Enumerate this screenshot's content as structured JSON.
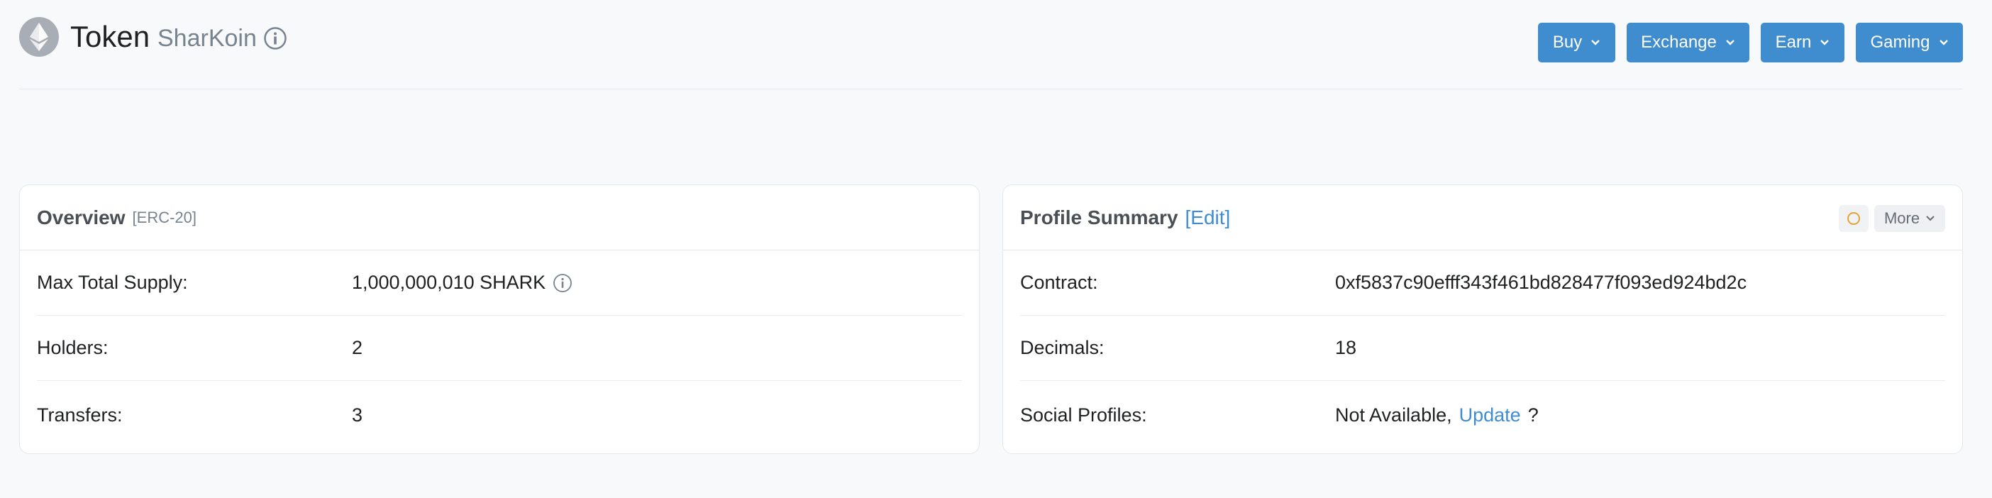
{
  "header": {
    "title": "Token",
    "token_name": "SharKoin",
    "buttons": [
      "Buy",
      "Exchange",
      "Earn",
      "Gaming"
    ]
  },
  "overview": {
    "title": "Overview",
    "standard": "[ERC-20]",
    "rows": [
      {
        "label": "Max Total Supply:",
        "value": "1,000,000,010 SHARK"
      },
      {
        "label": "Holders:",
        "value": "2"
      },
      {
        "label": "Transfers:",
        "value": "3"
      }
    ]
  },
  "profile": {
    "title": "Profile Summary",
    "edit": "[Edit]",
    "more": "More",
    "rows": [
      {
        "label": "Contract:",
        "value": "0xf5837c90efff343f461bd828477f093ed924bd2c"
      },
      {
        "label": "Decimals:",
        "value": "18"
      },
      {
        "label": "Social Profiles:",
        "value": "Not Available,",
        "link": "Update",
        "suffix": "?"
      }
    ]
  },
  "colors": {
    "accent": "#3f8ccf",
    "background": "#f8f9fb",
    "status_circle": "#e3a33a"
  },
  "icons": [
    "ethereum-logo-icon",
    "info-icon",
    "chevron-down-icon",
    "status-circle-icon"
  ]
}
